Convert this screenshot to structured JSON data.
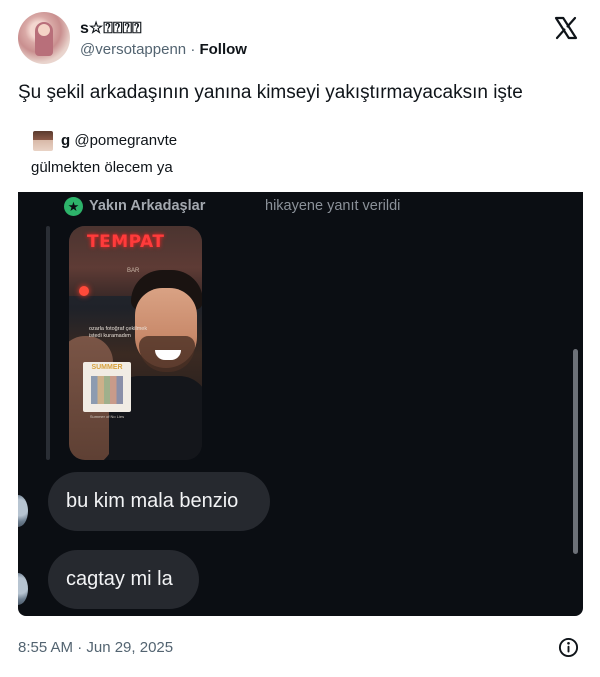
{
  "author": {
    "display_name": "s☆⍰⍰⍰⍰",
    "handle": "@versotappenn",
    "separator": "·",
    "follow_label": "Follow"
  },
  "tweet": {
    "text": "Şu şekil arkadaşının yanına kimseyi yakıştırmayacaksın işte"
  },
  "quote": {
    "display_name": "g",
    "handle": "@pomegranvte",
    "text": "gülmekten ölecem ya"
  },
  "media": {
    "reply_banner": {
      "icon": "star-icon",
      "strong": "Yakın Arkadaşlar",
      "rest": "hikayene yanıt verildi",
      "badge_color": "#2db36a"
    },
    "story": {
      "sign": "TEMPAT",
      "bar": "BAR",
      "caption": "ozarla fotoğraf çekilmek istedi kuramadım",
      "card_title": "SUMMER",
      "card_sub": "Summer of No Lies"
    },
    "messages": [
      {
        "text": "bu kim mala benzio"
      },
      {
        "text": "cagtay mi la"
      }
    ]
  },
  "footer": {
    "timestamp": "8:55 AM · Jun 29, 2025",
    "info_icon": "info-icon"
  }
}
